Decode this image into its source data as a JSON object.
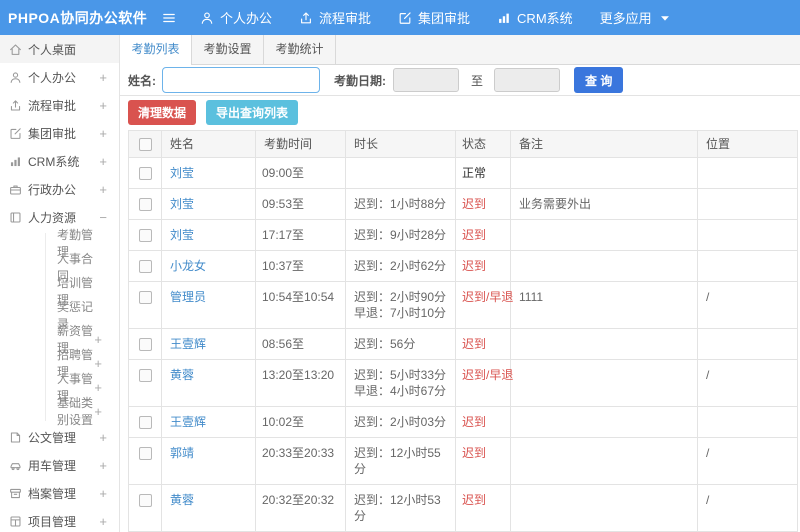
{
  "colors": {
    "topbar_bg": "#4a97e8",
    "link_blue": "#428bca",
    "status_red": "#d9534f",
    "danger_button": "#d9534f",
    "info_button": "#5bc0de",
    "primary_button": "#3a76dd"
  },
  "topbar": {
    "logo": "PHPOA协同办公软件",
    "nav": [
      {
        "id": "personal-office",
        "label": "个人办公",
        "icon": "user"
      },
      {
        "id": "workflow-approval",
        "label": "流程审批",
        "icon": "upload"
      },
      {
        "id": "group-approval",
        "label": "集团审批",
        "icon": "edit"
      },
      {
        "id": "crm-system",
        "label": "CRM系统",
        "icon": "chart"
      },
      {
        "id": "more-apps",
        "label": "更多应用",
        "caret": true
      }
    ]
  },
  "sidebar": {
    "items": [
      {
        "id": "personal-desktop",
        "label": "个人桌面",
        "icon": "home",
        "active": true
      },
      {
        "id": "personal-office",
        "label": "个人办公",
        "icon": "user",
        "expand": "+"
      },
      {
        "id": "workflow-approval",
        "label": "流程审批",
        "icon": "upload",
        "expand": "+"
      },
      {
        "id": "group-approval",
        "label": "集团审批",
        "icon": "edit",
        "expand": "+"
      },
      {
        "id": "crm-system",
        "label": "CRM系统",
        "icon": "chart",
        "expand": "+"
      },
      {
        "id": "admin-office",
        "label": "行政办公",
        "icon": "briefcase",
        "expand": "+"
      },
      {
        "id": "human-resources",
        "label": "人力资源",
        "icon": "book",
        "expand": "−",
        "children": [
          {
            "id": "attendance-mgmt",
            "label": "考勤管理"
          },
          {
            "id": "hr-contract",
            "label": "人事合同"
          },
          {
            "id": "training-mgmt",
            "label": "培训管理"
          },
          {
            "id": "reward-punish-record",
            "label": "奖惩记录"
          },
          {
            "id": "salary-mgmt",
            "label": "薪资管理",
            "expand": "+"
          },
          {
            "id": "recruit-mgmt",
            "label": "招聘管理",
            "expand": "+"
          },
          {
            "id": "personnel-mgmt",
            "label": "人事管理",
            "expand": "+"
          },
          {
            "id": "base-category-settings",
            "label": "基础类别设置",
            "expand": "+"
          }
        ]
      },
      {
        "id": "document-mgmt",
        "label": "公文管理",
        "icon": "doc",
        "expand": "+"
      },
      {
        "id": "vehicle-mgmt",
        "label": "用车管理",
        "icon": "car",
        "expand": "+"
      },
      {
        "id": "archive-mgmt",
        "label": "档案管理",
        "icon": "archive",
        "expand": "+"
      },
      {
        "id": "project-mgmt",
        "label": "项目管理",
        "icon": "project",
        "expand": "+"
      }
    ]
  },
  "tabs": [
    {
      "id": "attendance-list",
      "label": "考勤列表",
      "active": true
    },
    {
      "id": "attendance-settings",
      "label": "考勤设置"
    },
    {
      "id": "attendance-stats",
      "label": "考勤统计"
    }
  ],
  "search": {
    "name_label": "姓名:",
    "name_value": "",
    "date_label": "考勤日期:",
    "date_from": "",
    "to_label": "至",
    "date_to": "",
    "query_button": "查 询"
  },
  "toolbar": {
    "clean_button": "清理数据",
    "export_button": "导出查询列表"
  },
  "table": {
    "columns": [
      "姓名",
      "考勤时间",
      "时长",
      "状态",
      "备注",
      "位置"
    ],
    "rows": [
      {
        "name": "刘莹",
        "time": "09:00至",
        "duration": "",
        "status": "正常",
        "status_type": "normal",
        "note": "",
        "location": ""
      },
      {
        "name": "刘莹",
        "time": "09:53至",
        "duration": "迟到：1小时88分",
        "status": "迟到",
        "status_type": "late",
        "note": "业务需要外出",
        "location": ""
      },
      {
        "name": "刘莹",
        "time": "17:17至",
        "duration": "迟到：9小时28分",
        "status": "迟到",
        "status_type": "late",
        "note": "",
        "location": ""
      },
      {
        "name": "小龙女",
        "time": "10:37至",
        "duration": "迟到：2小时62分",
        "status": "迟到",
        "status_type": "late",
        "note": "",
        "location": ""
      },
      {
        "name": "管理员",
        "time": "10:54至10:54",
        "duration": "迟到：2小时90分\n早退：7小时10分",
        "status": "迟到/早退",
        "status_type": "late",
        "note": "1111",
        "location": "/"
      },
      {
        "name": "王壹辉",
        "time": "08:56至",
        "duration": "迟到：56分",
        "status": "迟到",
        "status_type": "late",
        "note": "",
        "location": ""
      },
      {
        "name": "黄蓉",
        "time": "13:20至13:20",
        "duration": "迟到：5小时33分\n早退：4小时67分",
        "status": "迟到/早退",
        "status_type": "late",
        "note": "",
        "location": "/"
      },
      {
        "name": "王壹辉",
        "time": "10:02至",
        "duration": "迟到：2小时03分",
        "status": "迟到",
        "status_type": "late",
        "note": "",
        "location": ""
      },
      {
        "name": "郭靖",
        "time": "20:33至20:33",
        "duration": "迟到：12小时55分",
        "status": "迟到",
        "status_type": "late",
        "note": "",
        "location": "/"
      },
      {
        "name": "黄蓉",
        "time": "20:32至20:32",
        "duration": "迟到：12小时53分",
        "status": "迟到",
        "status_type": "late",
        "note": "",
        "location": "/"
      }
    ]
  }
}
